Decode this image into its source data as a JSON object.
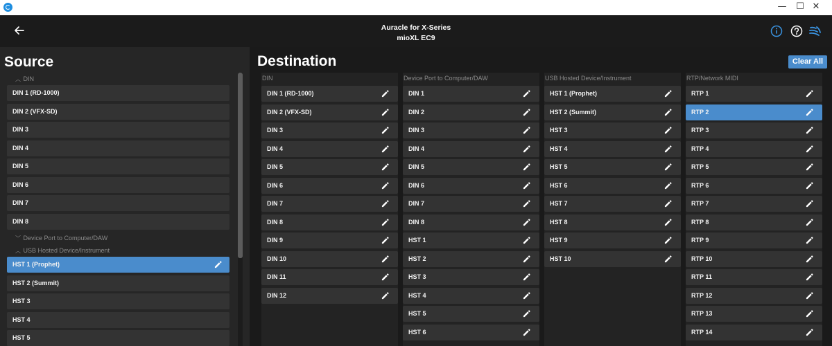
{
  "window": {
    "minimize": "—",
    "maximize": "☐",
    "close": "✕"
  },
  "header": {
    "title": "Auracle for X-Series",
    "subtitle": "mioXL EC9"
  },
  "source": {
    "title": "Source",
    "din_header": "DIN",
    "din_items": [
      "DIN 1 (RD-1000)",
      "DIN 2 (VFX-SD)",
      "DIN 3",
      "DIN 4",
      "DIN 5",
      "DIN 6",
      "DIN 7",
      "DIN 8"
    ],
    "device_port_header": "Device Port to Computer/DAW",
    "usb_header": "USB Hosted Device/Instrument",
    "hst_items": [
      "HST 1 (Prophet)",
      "HST 2 (Summit)",
      "HST 3",
      "HST 4",
      "HST 5"
    ],
    "selected": "HST 1 (Prophet)"
  },
  "destination": {
    "title": "Destination",
    "clear_all": "Clear All",
    "columns": [
      {
        "header": "DIN",
        "items": [
          "DIN 1 (RD-1000)",
          "DIN 2 (VFX-SD)",
          "DIN 3",
          "DIN 4",
          "DIN 5",
          "DIN 6",
          "DIN 7",
          "DIN 8",
          "DIN 9",
          "DIN 10",
          "DIN 11",
          "DIN 12"
        ]
      },
      {
        "header": "Device Port to Computer/DAW",
        "items": [
          "DIN 1",
          "DIN 2",
          "DIN 3",
          "DIN 4",
          "DIN 5",
          "DIN 6",
          "DIN 7",
          "DIN 8",
          "HST 1",
          "HST 2",
          "HST 3",
          "HST 4",
          "HST 5",
          "HST 6"
        ]
      },
      {
        "header": "USB Hosted Device/Instrument",
        "items": [
          "HST 1 (Prophet)",
          "HST 2 (Summit)",
          "HST 3",
          "HST 4",
          "HST 5",
          "HST 6",
          "HST 7",
          "HST 8",
          "HST 9",
          "HST 10"
        ]
      },
      {
        "header": "RTP/Network MIDI",
        "items": [
          "RTP 1",
          "RTP 2",
          "RTP 3",
          "RTP 4",
          "RTP 5",
          "RTP 6",
          "RTP 7",
          "RTP 8",
          "RTP 9",
          "RTP 10",
          "RTP 11",
          "RTP 12",
          "RTP 13",
          "RTP 14"
        ],
        "selected": "RTP 2"
      }
    ]
  },
  "colors": {
    "accent": "#4a8ccc",
    "item_bg": "#333333",
    "panel_bg": "#262626",
    "app_bg": "#1a1a1a"
  },
  "icons": {
    "back": "arrow-left-icon",
    "info": "info-icon",
    "help": "help-icon",
    "network": "wave-icon",
    "edit": "pencil-icon",
    "collapse": "chevron-up-icon"
  }
}
